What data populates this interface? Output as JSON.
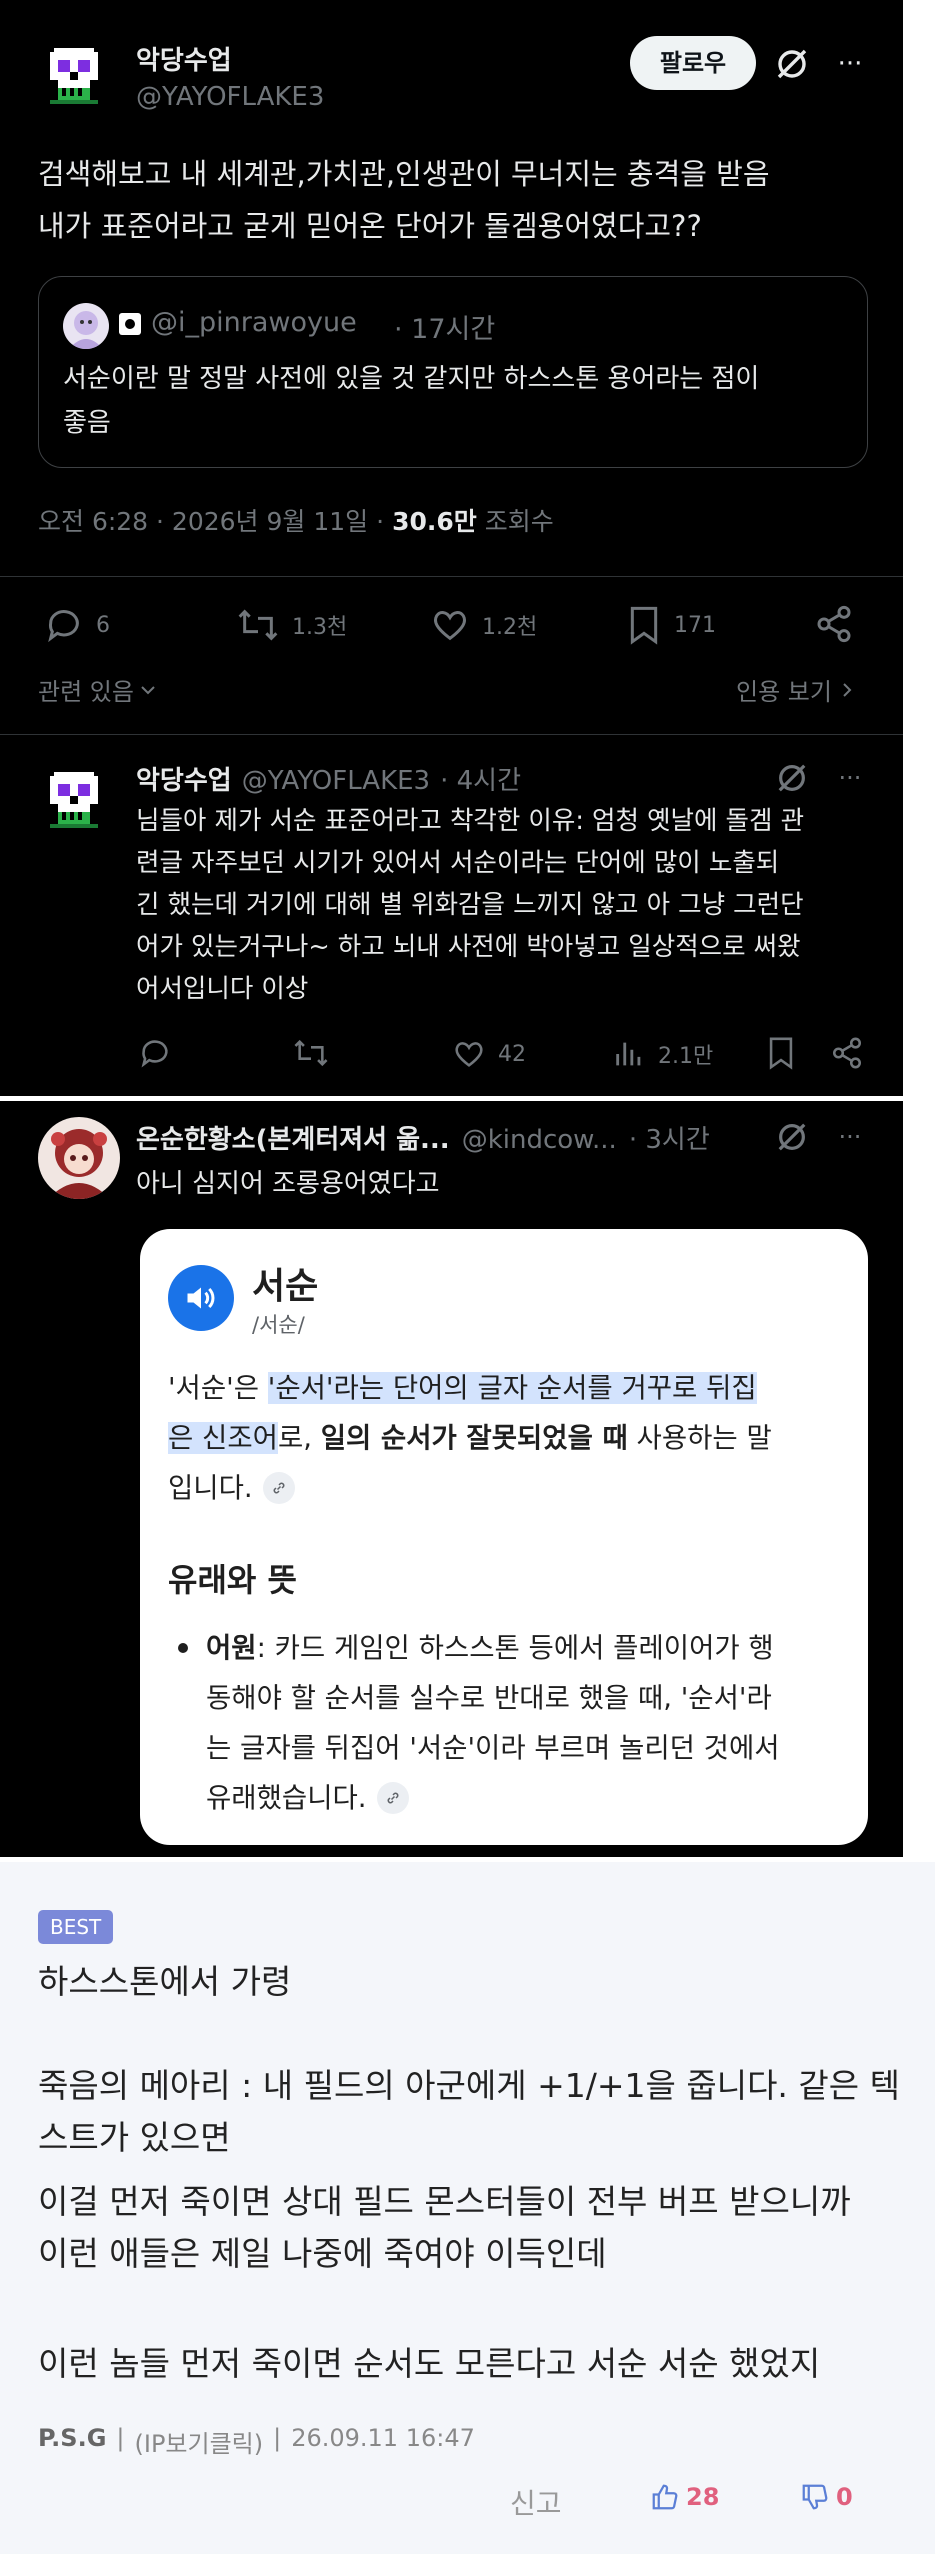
{
  "tweet": {
    "author_name": "악당수업",
    "author_handle": "@YAYOFLAKE3",
    "follow_label": "팔로우",
    "more_label": "···",
    "lines": [
      "검색해보고 내 세계관,가치관,인생관이 무너지는 충격을 받음",
      "내가 표준어라고 굳게 믿어온 단어가 돌겜용어였다고??"
    ],
    "quote": {
      "handle": "@i_pinrawoyue",
      "time": "· 17시간",
      "lines": [
        "서순이란 말 정말 사전에 있을 것 같지만 하스스톤 용어라는 점이",
        "좋음"
      ]
    },
    "meta_prefix": "오전 6:28 · 2026년 9월 11일 ·",
    "meta_views": "30.6만",
    "meta_suffix": "조회수",
    "stats": {
      "replies": "6",
      "retweets": "1.3천",
      "likes": "1.2천",
      "bookmarks": "171"
    },
    "related_label": "관련 있음",
    "quote_view_label": "인용 보기"
  },
  "reply1": {
    "author_name": "악당수업",
    "author_handle": "@YAYOFLAKE3",
    "time": "· 4시간",
    "lines": [
      "님들아 제가 서순 표준어라고 착각한 이유: 엄청 옛날에 돌겜 관",
      "련글 자주보던 시기가 있어서 서순이라는 단어에 많이 노출되",
      "긴 했는데 거기에 대해 별 위화감을 느끼지 않고 아 그냥 그런단",
      "어가 있는거구나~ 하고 뇌내 사전에 박아넣고 일상적으로 써왔",
      "어서입니다 이상"
    ],
    "stats": {
      "likes": "42",
      "views": "2.1만"
    }
  },
  "reply2": {
    "author_name": "온순한황소(본계터져서 옮...",
    "author_handle": "@kindcow...",
    "time": "· 3시간",
    "text": "아니 심지어 조롱용어였다고",
    "card": {
      "word": "서순",
      "pron": "/서순/",
      "def_a": "'서순'은 ",
      "def_hl1": "'순서'라는 단어의 글자 순서를 거꾸로 뒤집",
      "def_hl2": "은 신조어",
      "def_b": "로, ",
      "def_bold": "일의 순서가 잘못되었을 때",
      "def_c": " 사용하는 말",
      "def_d": "입니다.",
      "section_title": "유래와 뜻",
      "bullet_bold": "어원",
      "bullet_lines": [
        ": 카드 게임인 하스스톤 등에서 플레이어가 행",
        "동해야 할 순서를 실수로 반대로 했을 때, '순서'라",
        "는 글자를 뒤집어 '서순'이라 부르며 놀리던 것에서",
        "유래했습니다."
      ]
    }
  },
  "comment": {
    "badge": "BEST",
    "lines": [
      "하스스톤에서 가령",
      "",
      "죽음의 메아리 : 내 필드의 아군에게 +1/+1을 줍니다. 같은 텍",
      "스트가 있으면",
      "이걸 먼저 죽이면 상대 필드 몬스터들이 전부 버프 받으니까",
      "이런 애들은 제일 나중에 죽여야 이득인데",
      "",
      "이런 놈들 먼저 죽이면 순서도 모른다고 서순 서순 했었지"
    ],
    "author": "P.S.G",
    "ip_label": "(IP보기클릭)",
    "date": "26.09.11 16:47",
    "report_label": "신고",
    "upvotes": "28",
    "downvotes": "0",
    "colors": {
      "up": "#e0607e",
      "down": "#e0607e",
      "badge": "#7b89d9"
    }
  }
}
